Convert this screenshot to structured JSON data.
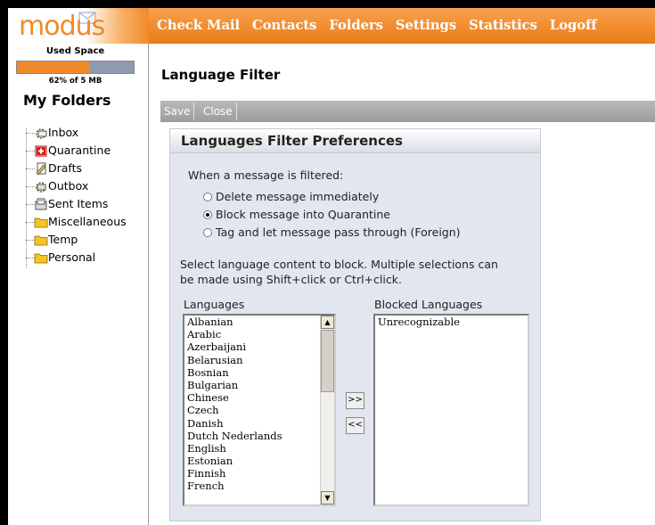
{
  "header": {
    "logo_text": "modus",
    "nav": [
      "Check Mail",
      "Contacts",
      "Folders",
      "Settings",
      "Statistics",
      "Logoff"
    ],
    "accent_color": "#f08a2a"
  },
  "sidebar": {
    "used_space_label": "Used Space",
    "used_space_percent": 62,
    "used_space_text": "62% of 5 MB",
    "my_folders_label": "My Folders",
    "folders": [
      {
        "label": "Inbox",
        "icon": "inbox-icon"
      },
      {
        "label": "Quarantine",
        "icon": "quarantine-icon"
      },
      {
        "label": "Drafts",
        "icon": "drafts-icon"
      },
      {
        "label": "Outbox",
        "icon": "outbox-icon"
      },
      {
        "label": "Sent Items",
        "icon": "sent-items-icon"
      },
      {
        "label": "Miscellaneous",
        "icon": "folder-icon"
      },
      {
        "label": "Temp",
        "icon": "folder-icon"
      },
      {
        "label": "Personal",
        "icon": "folder-icon"
      }
    ]
  },
  "main": {
    "page_title": "Language Filter",
    "toolbar": {
      "save_label": "Save",
      "close_label": "Close"
    },
    "panel": {
      "title": "Languages Filter Preferences",
      "filter_prompt": "When a message is filtered:",
      "options": [
        {
          "label": "Delete message immediately",
          "selected": false
        },
        {
          "label": "Block message into Quarantine",
          "selected": true
        },
        {
          "label": "Tag and let message pass through (Foreign)",
          "selected": false
        }
      ],
      "instructions_line1": "Select language content to block. Multiple selections can",
      "instructions_line2": "be made using Shift+click or Ctrl+click.",
      "languages_label": "Languages",
      "blocked_label": "Blocked Languages",
      "languages": [
        "Albanian",
        "Arabic",
        "Azerbaijani",
        "Belarusian",
        "Bosnian",
        "Bulgarian",
        "Chinese",
        "Czech",
        "Danish",
        "Dutch Nederlands",
        "English",
        "Estonian",
        "Finnish",
        "French"
      ],
      "blocked_languages": [
        "Unrecognizable"
      ],
      "add_label": ">>",
      "remove_label": "<<"
    }
  }
}
